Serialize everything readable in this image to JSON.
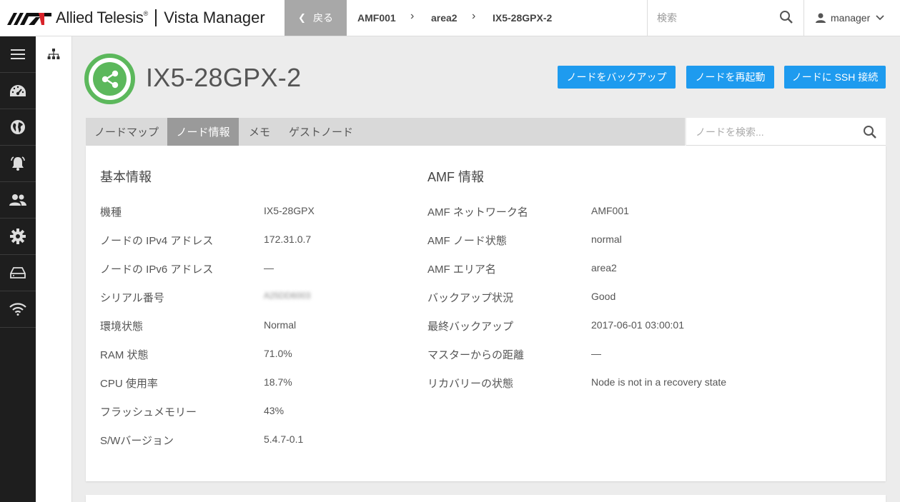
{
  "brand": {
    "name": "Allied Telesis",
    "trademark": "®",
    "product": "Vista Manager"
  },
  "topbar": {
    "back_label": "戻る",
    "breadcrumb": [
      "AMF001",
      "area2",
      "IX5-28GPX-2"
    ],
    "search_placeholder": "検索",
    "user": "manager"
  },
  "sidenav": {
    "items": [
      "menu-icon",
      "dashboard-icon",
      "globe-icon",
      "alarm-bell-icon",
      "users-icon",
      "gear-icon",
      "storage-drive-icon",
      "wifi-icon"
    ]
  },
  "node": {
    "title": "IX5-28GPX-2",
    "status_color": "#5cb85c",
    "actions": [
      "ノードをバックアップ",
      "ノードを再起動",
      "ノードに SSH 接続"
    ]
  },
  "tabs": {
    "items": [
      "ノードマップ",
      "ノード情報",
      "メモ",
      "ゲストノード"
    ],
    "active": "ノード情報",
    "search_placeholder": "ノードを検索..."
  },
  "basic_info": {
    "title": "基本情報",
    "rows": [
      {
        "label": "機種",
        "value": "IX5-28GPX"
      },
      {
        "label": "ノードの IPv4 アドレス",
        "value": "172.31.0.7"
      },
      {
        "label": "ノードの IPv6 アドレス",
        "value": "—"
      },
      {
        "label": "シリアル番号",
        "value": "A25DD6003"
      },
      {
        "label": "環境状態",
        "value": "Normal"
      },
      {
        "label": "RAM 状態",
        "value": "71.0%"
      },
      {
        "label": "CPU 使用率",
        "value": "18.7%"
      },
      {
        "label": "フラッシュメモリー",
        "value": "43%"
      },
      {
        "label": "S/Wバージョン",
        "value": "5.4.7-0.1"
      }
    ]
  },
  "amf_info": {
    "title": "AMF 情報",
    "rows": [
      {
        "label": "AMF ネットワーク名",
        "value": "AMF001"
      },
      {
        "label": "AMF ノード状態",
        "value": "normal"
      },
      {
        "label": "AMF エリア名",
        "value": "area2"
      },
      {
        "label": "バックアップ状況",
        "value": "Good"
      },
      {
        "label": "最終バックアップ",
        "value": "2017-06-01 03:00:01"
      },
      {
        "label": "マスターからの距離",
        "value": "—"
      },
      {
        "label": "リカバリーの状態",
        "value": "Node is not in a recovery state"
      }
    ]
  },
  "colors": {
    "accent": "#1e9bef",
    "status_ok": "#5cb85c",
    "sidenav": "#1e1e1e"
  }
}
